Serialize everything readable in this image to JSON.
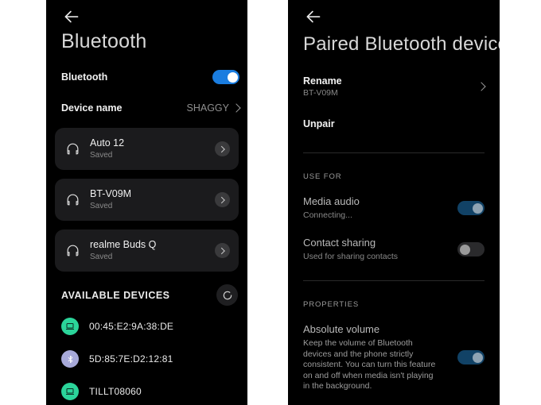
{
  "left_screen": {
    "back_icon": "back-arrow-icon",
    "title": "Bluetooth",
    "bluetooth_row": {
      "label": "Bluetooth",
      "toggle_state": "on"
    },
    "device_name_row": {
      "label": "Device name",
      "value": "SHAGGY",
      "chevron_icon": "chevron-right-icon"
    },
    "paired_devices": [
      {
        "name": "Auto 12",
        "status": "Saved",
        "icon": "headset-icon",
        "chevron_icon": "chevron-right-icon"
      },
      {
        "name": "BT-V09M",
        "status": "Saved",
        "icon": "headset-icon",
        "chevron_icon": "chevron-right-icon"
      },
      {
        "name": "realme Buds Q",
        "status": "Saved",
        "icon": "headset-icon",
        "chevron_icon": "chevron-right-icon"
      }
    ],
    "available_section": {
      "title": "AVAILABLE DEVICES",
      "refresh_icon": "refresh-spinner-icon",
      "devices": [
        {
          "name": "00:45:E2:9A:38:DE",
          "icon": "laptop-icon",
          "badge_color": "#2bd49a"
        },
        {
          "name": "5D:85:7E:D2:12:81",
          "icon": "bluetooth-icon",
          "badge_color": "#a7a9d9"
        },
        {
          "name": "TILLT08060",
          "icon": "laptop-icon",
          "badge_color": "#2bd49a"
        }
      ]
    }
  },
  "right_screen": {
    "back_icon": "back-arrow-icon",
    "title": "Paired Bluetooth device",
    "rename": {
      "label": "Rename",
      "value": "BT-V09M",
      "chevron_icon": "chevron-right-icon"
    },
    "unpair": {
      "label": "Unpair"
    },
    "use_for": {
      "caption": "USE FOR",
      "items": [
        {
          "title": "Media audio",
          "subtitle": "Connecting...",
          "toggle_state": "on-dim"
        },
        {
          "title": "Contact sharing",
          "subtitle": "Used for sharing contacts",
          "toggle_state": "off"
        }
      ]
    },
    "properties": {
      "caption": "PROPERTIES",
      "items": [
        {
          "title": "Absolute volume",
          "description": "Keep the volume of Bluetooth devices and the phone strictly consistent. You can turn this feature on and off when media isn't playing in the background.",
          "toggle_state": "on-dim"
        }
      ]
    }
  },
  "colors": {
    "accent_blue": "#1a7de0",
    "dim_blue": "#114266",
    "panel_bg": "#000000",
    "card_bg": "#1b1b1d"
  }
}
